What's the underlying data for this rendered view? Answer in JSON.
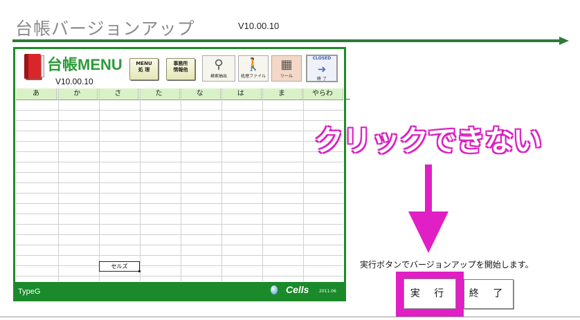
{
  "header": {
    "title": "台帳バージョンアップ",
    "version": "V10.00.10"
  },
  "panel": {
    "menu_title": "台帳MENU",
    "version": "V10.00.10",
    "toolbar": {
      "menu_button": [
        "MENU",
        "処 理"
      ],
      "office_button": [
        "事務所",
        "情報他"
      ],
      "search_caption": "検索抽出",
      "file_caption": "処理ファイル",
      "tools_caption": "ツール",
      "closed_caption": "CLOSED",
      "closed_sub": "終 了"
    },
    "columns": [
      "あ",
      "か",
      "さ",
      "た",
      "な",
      "は",
      "ま",
      "やらわ"
    ],
    "selected_cell": "セルズ",
    "status": {
      "type": "TypeG",
      "brand": "Cells",
      "date": "2011.06"
    }
  },
  "annotation": {
    "text": "クリックできない",
    "color": "#e01fc4"
  },
  "footer": {
    "instruction": "実行ボタンでバージョンアップを開始します。",
    "execute_label": "実 行",
    "exit_label": "終 了"
  },
  "colors": {
    "accent_green": "#1e8a2a",
    "highlight_magenta": "#e01fc4"
  }
}
